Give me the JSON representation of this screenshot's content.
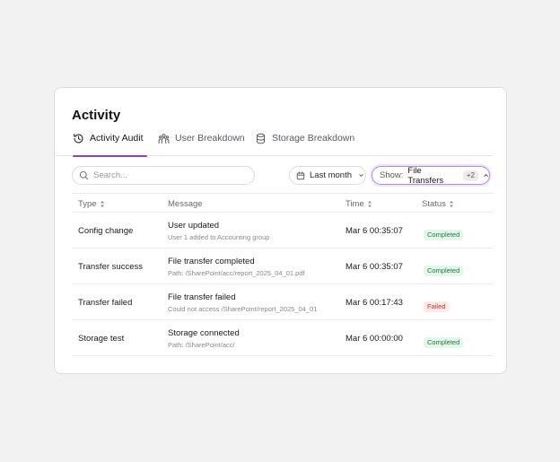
{
  "page": {
    "title": "Activity"
  },
  "tabs": [
    {
      "label": "Activity Audit",
      "icon": "history-icon",
      "active": true
    },
    {
      "label": "User Breakdown",
      "icon": "users-icon",
      "active": false
    },
    {
      "label": "Storage Breakdown",
      "icon": "database-icon",
      "active": false
    }
  ],
  "filters": {
    "search_placeholder": "Search...",
    "date_range": "Last month",
    "show_prefix": "Show:",
    "show_value": "File Transfers",
    "show_extra": "+2"
  },
  "table": {
    "columns": [
      "Type",
      "Message",
      "Time",
      "Status"
    ],
    "rows": [
      {
        "type": "Config change",
        "message": "User updated",
        "detail": "User 1 added to Accounting group",
        "time": "Mar 6 00:35:07",
        "status": "Completed"
      },
      {
        "type": "Transfer success",
        "message": "File transfer completed",
        "detail": "Path: /SharePoint/acc/report_2025_04_01.pdf",
        "time": "Mar 6 00:35:07",
        "status": "Completed"
      },
      {
        "type": "Transfer failed",
        "message": "File transfer failed",
        "detail": "Could not access /SharePoint/report_2025_04_01",
        "time": "Mar 6 00:17:43",
        "status": "Failed"
      },
      {
        "type": "Storage test",
        "message": "Storage connected",
        "detail": "Path: /SharePoint/acc/",
        "time": "Mar 6 00:00:00",
        "status": "Completed"
      }
    ]
  },
  "colors": {
    "accent": "#8b3fd9",
    "completed_bg": "#e3f6e9",
    "completed_text": "#227a45",
    "failed_bg": "#fde8e8",
    "failed_text": "#c23535"
  }
}
